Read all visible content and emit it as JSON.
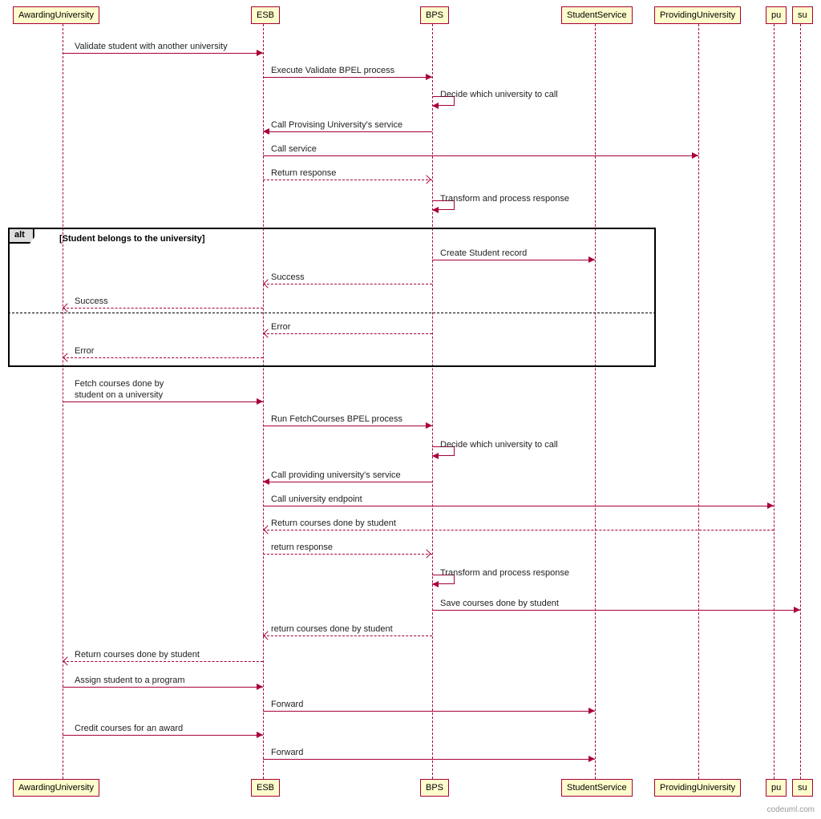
{
  "chart_data": {
    "type": "diagram",
    "diagram_type": "sequence",
    "participants": [
      "AwardingUniversity",
      "ESB",
      "BPS",
      "StudentService",
      "ProvidingUniversity",
      "pu",
      "su"
    ],
    "messages": [
      {
        "from": "AwardingUniversity",
        "to": "ESB",
        "type": "solid",
        "label": "Validate student with another university"
      },
      {
        "from": "ESB",
        "to": "BPS",
        "type": "solid",
        "label": "Execute Validate BPEL process"
      },
      {
        "from": "BPS",
        "to": "BPS",
        "type": "self",
        "label": "Decide which university to call"
      },
      {
        "from": "BPS",
        "to": "ESB",
        "type": "solid",
        "label": "Call Provising University's service"
      },
      {
        "from": "ESB",
        "to": "ProvidingUniversity",
        "type": "solid",
        "label": "Call service"
      },
      {
        "from": "ESB",
        "to": "BPS",
        "type": "dashed",
        "label": "Return response"
      },
      {
        "from": "BPS",
        "to": "BPS",
        "type": "self",
        "label": "Transform and process response"
      },
      {
        "alt": "Student belongs to the university",
        "branches": [
          [
            {
              "from": "BPS",
              "to": "StudentService",
              "type": "solid",
              "label": "Create Student record"
            },
            {
              "from": "BPS",
              "to": "ESB",
              "type": "dashed",
              "label": "Success"
            },
            {
              "from": "ESB",
              "to": "AwardingUniversity",
              "type": "dashed",
              "label": "Success"
            }
          ],
          [
            {
              "from": "BPS",
              "to": "ESB",
              "type": "dashed",
              "label": "Error"
            },
            {
              "from": "ESB",
              "to": "AwardingUniversity",
              "type": "dashed",
              "label": "Error"
            }
          ]
        ]
      },
      {
        "from": "AwardingUniversity",
        "to": "ESB",
        "type": "solid",
        "label": "Fetch courses done by student on a university"
      },
      {
        "from": "ESB",
        "to": "BPS",
        "type": "solid",
        "label": "Run FetchCourses BPEL process"
      },
      {
        "from": "BPS",
        "to": "BPS",
        "type": "self",
        "label": "Decide which university to call"
      },
      {
        "from": "BPS",
        "to": "ESB",
        "type": "solid",
        "label": "Call providing university's service"
      },
      {
        "from": "ESB",
        "to": "pu",
        "type": "solid",
        "label": "Call university endpoint"
      },
      {
        "from": "pu",
        "to": "ESB",
        "type": "dashed",
        "label": "Return courses done by student"
      },
      {
        "from": "ESB",
        "to": "BPS",
        "type": "dashed",
        "label": "return response"
      },
      {
        "from": "BPS",
        "to": "BPS",
        "type": "self",
        "label": "Transform and process response"
      },
      {
        "from": "BPS",
        "to": "su",
        "type": "solid",
        "label": "Save courses done by student"
      },
      {
        "from": "BPS",
        "to": "ESB",
        "type": "dashed",
        "label": "return courses done by student"
      },
      {
        "from": "ESB",
        "to": "AwardingUniversity",
        "type": "dashed",
        "label": "Return courses done by student"
      },
      {
        "from": "AwardingUniversity",
        "to": "ESB",
        "type": "solid",
        "label": "Assign student to a program"
      },
      {
        "from": "ESB",
        "to": "StudentService",
        "type": "solid",
        "label": "Forward"
      },
      {
        "from": "AwardingUniversity",
        "to": "ESB",
        "type": "solid",
        "label": "Credit courses for an award"
      },
      {
        "from": "ESB",
        "to": "StudentService",
        "type": "solid",
        "label": "Forward"
      }
    ]
  },
  "p": {
    "p0": "AwardingUniversity",
    "p1": "ESB",
    "p2": "BPS",
    "p3": "StudentService",
    "p4": "ProvidingUniversity",
    "p5": "pu",
    "p6": "su"
  },
  "m": {
    "m0": "Validate student with another university",
    "m1": "Execute Validate BPEL process",
    "m2": "Decide which university to call",
    "m3": "Call Provising University's service",
    "m4": "Call service",
    "m5": "Return response",
    "m6": "Transform and process response",
    "m7": "Create Student record",
    "m8": "Success",
    "m9": "Success",
    "m10": "Error",
    "m11": "Error",
    "m12l1": "Fetch courses done by",
    "m12l2": "student on a university",
    "m13": "Run FetchCourses BPEL process",
    "m14": "Decide which university to call",
    "m15": "Call providing university's service",
    "m16": "Call university endpoint",
    "m17": "Return courses done by student",
    "m18": "return response",
    "m19": "Transform and process response",
    "m20": "Save courses done by student",
    "m21": "return courses done by student",
    "m22": "Return courses done by student",
    "m23": "Assign student to a program",
    "m24": "Forward",
    "m25": "Credit courses for an award",
    "m26": "Forward"
  },
  "alt": {
    "tag": "alt",
    "cond": "[Student belongs to the university]"
  },
  "watermark": "codeuml.com"
}
